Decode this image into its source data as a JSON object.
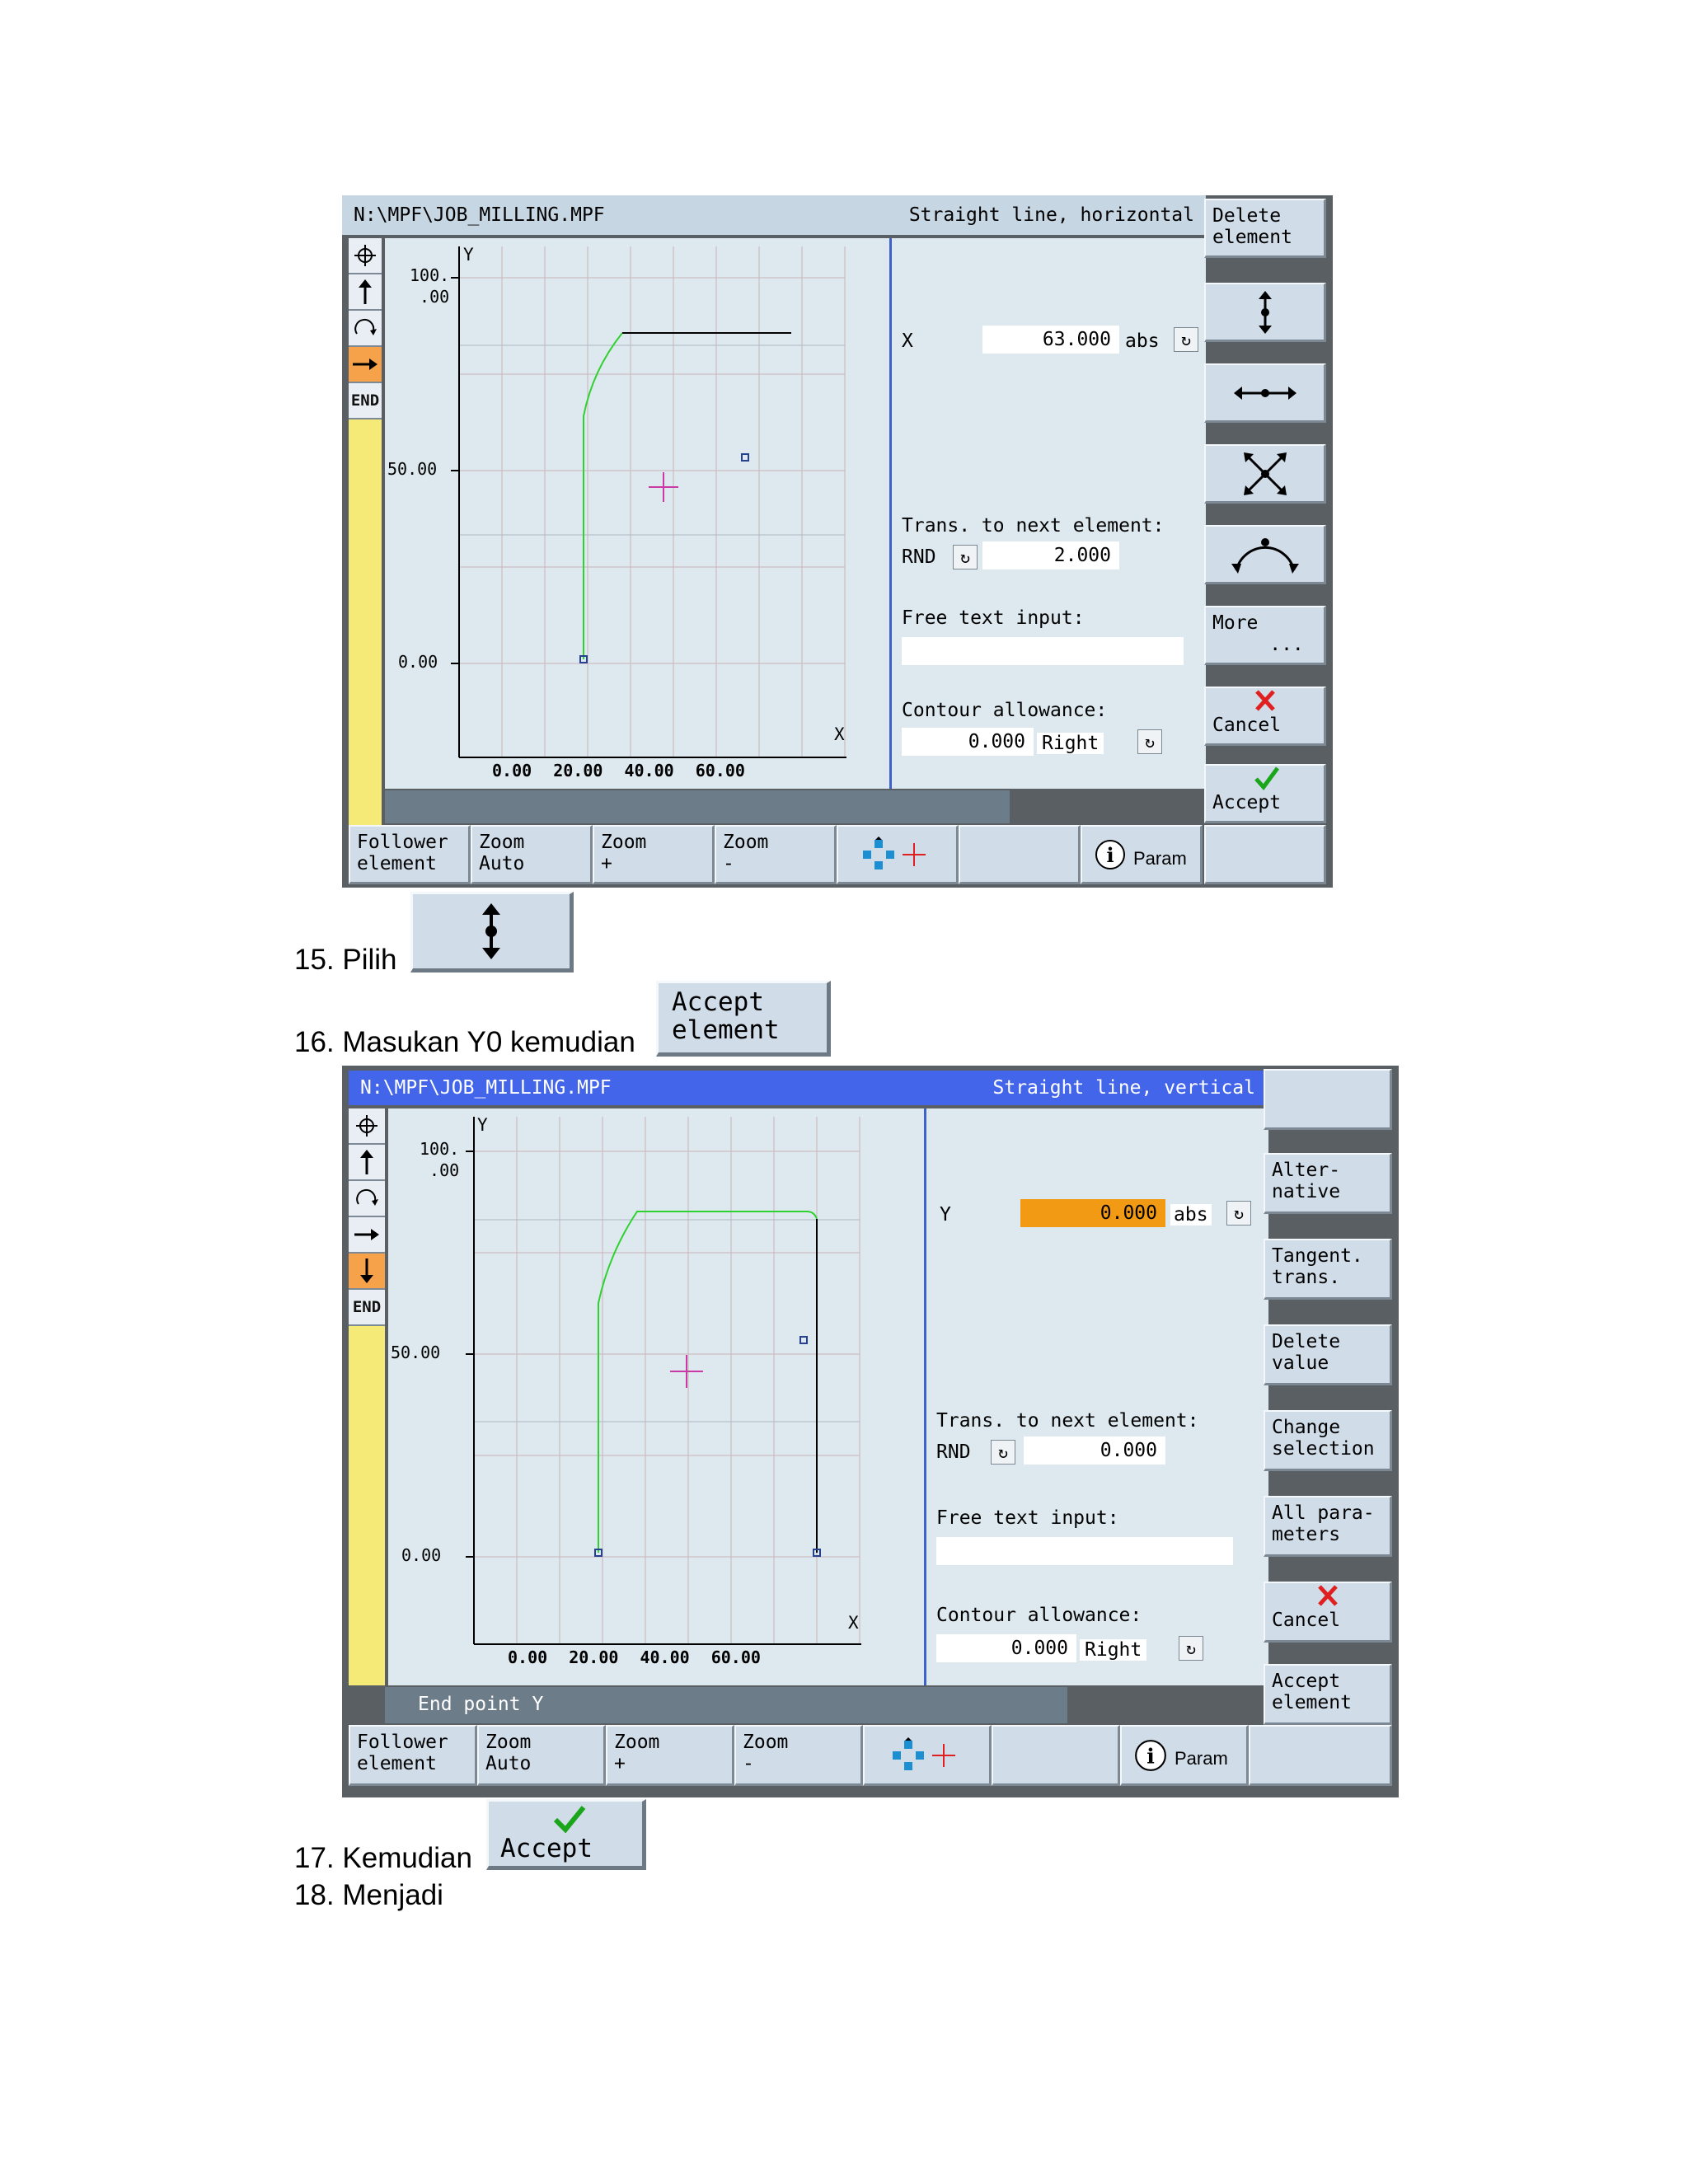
{
  "screen1": {
    "path": "N:\\MPF\\JOB_MILLING.MPF",
    "mode": "Straight line, horizontal",
    "tools": [
      "END"
    ],
    "y_axis_label": "Y",
    "x_axis_label": "X",
    "y_ticks": [
      "100.\n.00",
      "50.00",
      "0.00"
    ],
    "x_ticks": "0.00 20.00 40.00 60.00",
    "field_x_label": "X",
    "field_x_value": "63.000",
    "field_x_unit": "abs",
    "trans_label": "Trans. to next element:",
    "trans_type": "RND",
    "trans_value": "2.000",
    "free_text_label": "Free text input:",
    "allowance_label": "Contour allowance:",
    "allowance_value": "0.000",
    "allowance_side": "Right",
    "right_softkeys": {
      "delete_element": "Delete\nelement",
      "more": "More\n     ...",
      "cancel": "Cancel",
      "accept": "Accept"
    },
    "bottom_softkeys": [
      "Follower\nelement",
      "Zoom\nAuto",
      "Zoom\n+",
      "Zoom\n-",
      "",
      "",
      "Param",
      ""
    ]
  },
  "step15": {
    "text": "15. Pilih"
  },
  "step16": {
    "text": "16. Masukan Y0 kemudian",
    "button": "Accept\nelement"
  },
  "screen2": {
    "path": "N:\\MPF\\JOB_MILLING.MPF",
    "mode": "Straight line, vertical",
    "tools": [
      "END"
    ],
    "y_axis_label": "Y",
    "x_axis_label": "X",
    "y_ticks": [
      "100.\n.00",
      "50.00",
      "0.00"
    ],
    "x_ticks": "0.00 20.00 40.00 60.00",
    "field_y_label": "Y",
    "field_y_value": "0.000",
    "field_y_unit": "abs",
    "trans_label": "Trans. to next element:",
    "trans_type": "RND",
    "trans_value": "0.000",
    "free_text_label": "Free text input:",
    "allowance_label": "Contour allowance:",
    "allowance_value": "0.000",
    "allowance_side": "Right",
    "status_text": "End point Y",
    "right_softkeys": {
      "alternative": "Alter-\nnative",
      "tangent": "Tangent.\ntrans.",
      "delete_value": "Delete\nvalue",
      "change_selection": "Change\nselection",
      "all_parameters": "All para-\nmeters",
      "cancel": "Cancel",
      "accept_element": "Accept\nelement"
    },
    "bottom_softkeys": [
      "Follower\nelement",
      "Zoom\nAuto",
      "Zoom\n+",
      "Zoom\n-",
      "",
      "",
      "Param",
      ""
    ]
  },
  "step17": {
    "text": "17. Kemudian",
    "button": "Accept"
  },
  "step18": {
    "text": "18. Menjadi"
  },
  "colors": {
    "accent_blue": "#4365ea",
    "active_orange": "#f39a14",
    "contour_green": "#2fd12f"
  }
}
